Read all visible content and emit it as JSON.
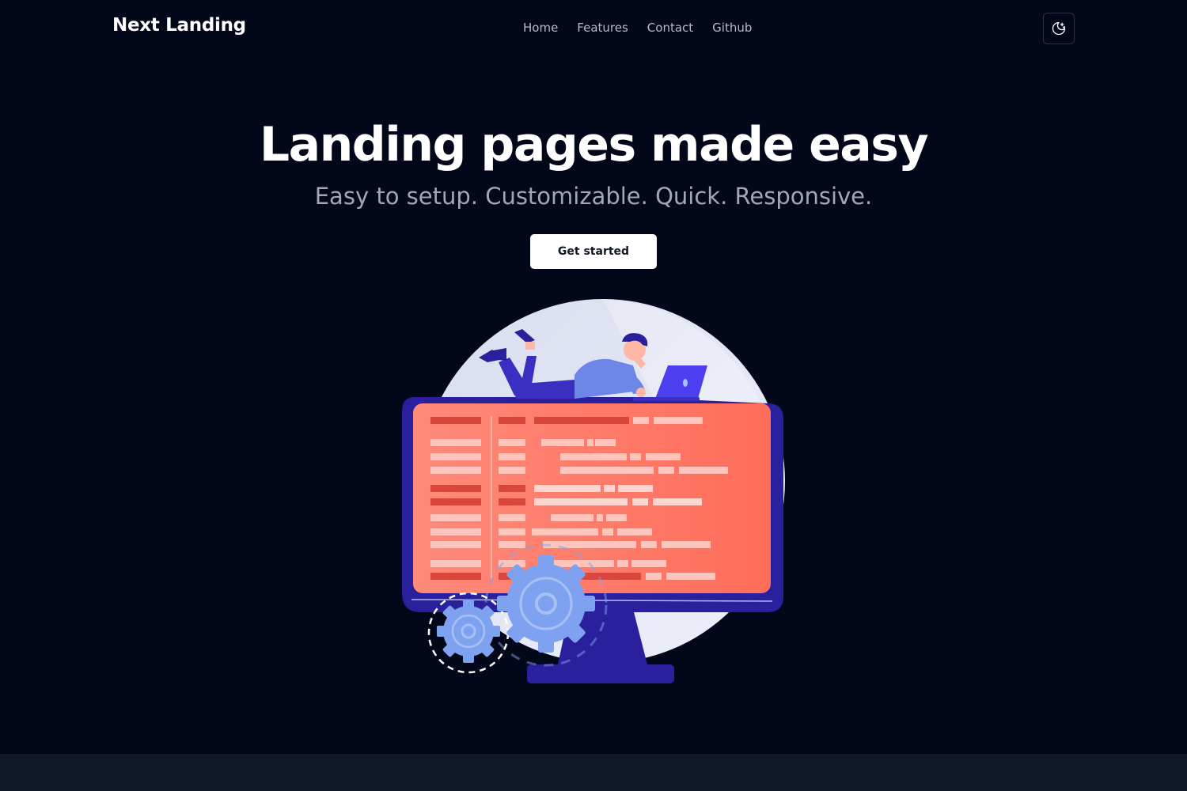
{
  "navbar": {
    "brand": "Next Landing",
    "links": [
      {
        "label": "Home"
      },
      {
        "label": "Features"
      },
      {
        "label": "Contact"
      },
      {
        "label": "Github"
      }
    ],
    "theme_toggle_icon": "moon-stars-icon"
  },
  "hero": {
    "title": "Landing pages made easy",
    "subtitle": "Easy to setup. Customizable. Quick. Responsive.",
    "cta_label": "Get started"
  },
  "illustration": {
    "subject": "person-lying-on-monitor-illustration",
    "colors": {
      "circle": "#e2e6f7",
      "monitor_frame": "#2a1f9c",
      "screen": "#ff7966",
      "gear": "#7ea2f0",
      "shirt": "#6d86e8"
    }
  },
  "colors": {
    "background": "#03071a",
    "footer_band": "#111827",
    "nav_text": "#b4bcc8",
    "subtitle": "#a0a8b6"
  }
}
